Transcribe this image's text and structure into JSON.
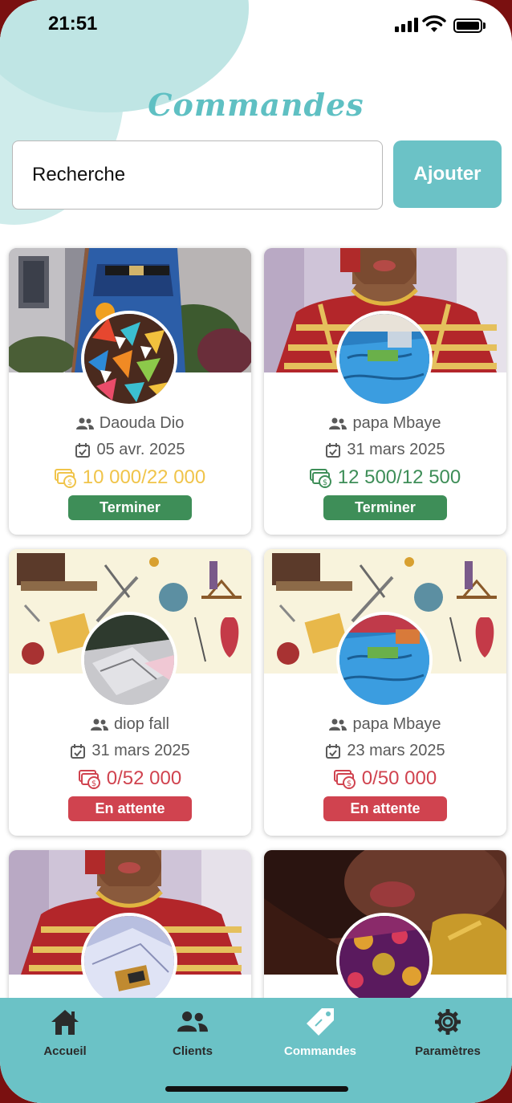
{
  "status_bar": {
    "time": "21:51"
  },
  "header": {
    "title": "Commandes"
  },
  "search": {
    "placeholder": "Recherche",
    "value": ""
  },
  "add_button": {
    "label": "Ajouter"
  },
  "orders": [
    {
      "client": "Daouda Dio",
      "date": "05 avr. 2025",
      "amount": "10 000/22 000",
      "status": "Terminer",
      "amount_color": "#f0c44a",
      "status_color": "#3e8e58",
      "cover": "blue-dress",
      "avatar": "triangle-fabric"
    },
    {
      "client": "papa Mbaye",
      "date": "31 mars 2025",
      "amount": "12 500/12 500",
      "status": "Terminer",
      "amount_color": "#3e8e58",
      "status_color": "#3e8e58",
      "cover": "red-gold-dress",
      "avatar": "blue-fabric"
    },
    {
      "client": "diop fall",
      "date": "31 mars 2025",
      "amount": "0/52 000",
      "status": "En attente",
      "amount_color": "#d0434f",
      "status_color": "#d0434f",
      "cover": "sewing-pattern",
      "avatar": "silver-fabric"
    },
    {
      "client": "papa Mbaye",
      "date": "23 mars 2025",
      "amount": "0/50 000",
      "status": "En attente",
      "amount_color": "#d0434f",
      "status_color": "#d0434f",
      "cover": "sewing-pattern",
      "avatar": "blue-fabric"
    },
    {
      "cover": "red-gold-dress",
      "avatar": "white-fabric"
    },
    {
      "cover": "face-portrait",
      "avatar": "purple-fabric"
    }
  ],
  "tabbar": {
    "items": [
      {
        "label": "Accueil",
        "icon": "home-icon",
        "active": false
      },
      {
        "label": "Clients",
        "icon": "users-icon",
        "active": false
      },
      {
        "label": "Commandes",
        "icon": "tag-icon",
        "active": true
      },
      {
        "label": "Paramètres",
        "icon": "gear-icon",
        "active": false
      }
    ]
  },
  "colors": {
    "accent": "#6bc2c6",
    "done": "#3e8e58",
    "pending": "#d0434f",
    "partial": "#f0c44a"
  }
}
